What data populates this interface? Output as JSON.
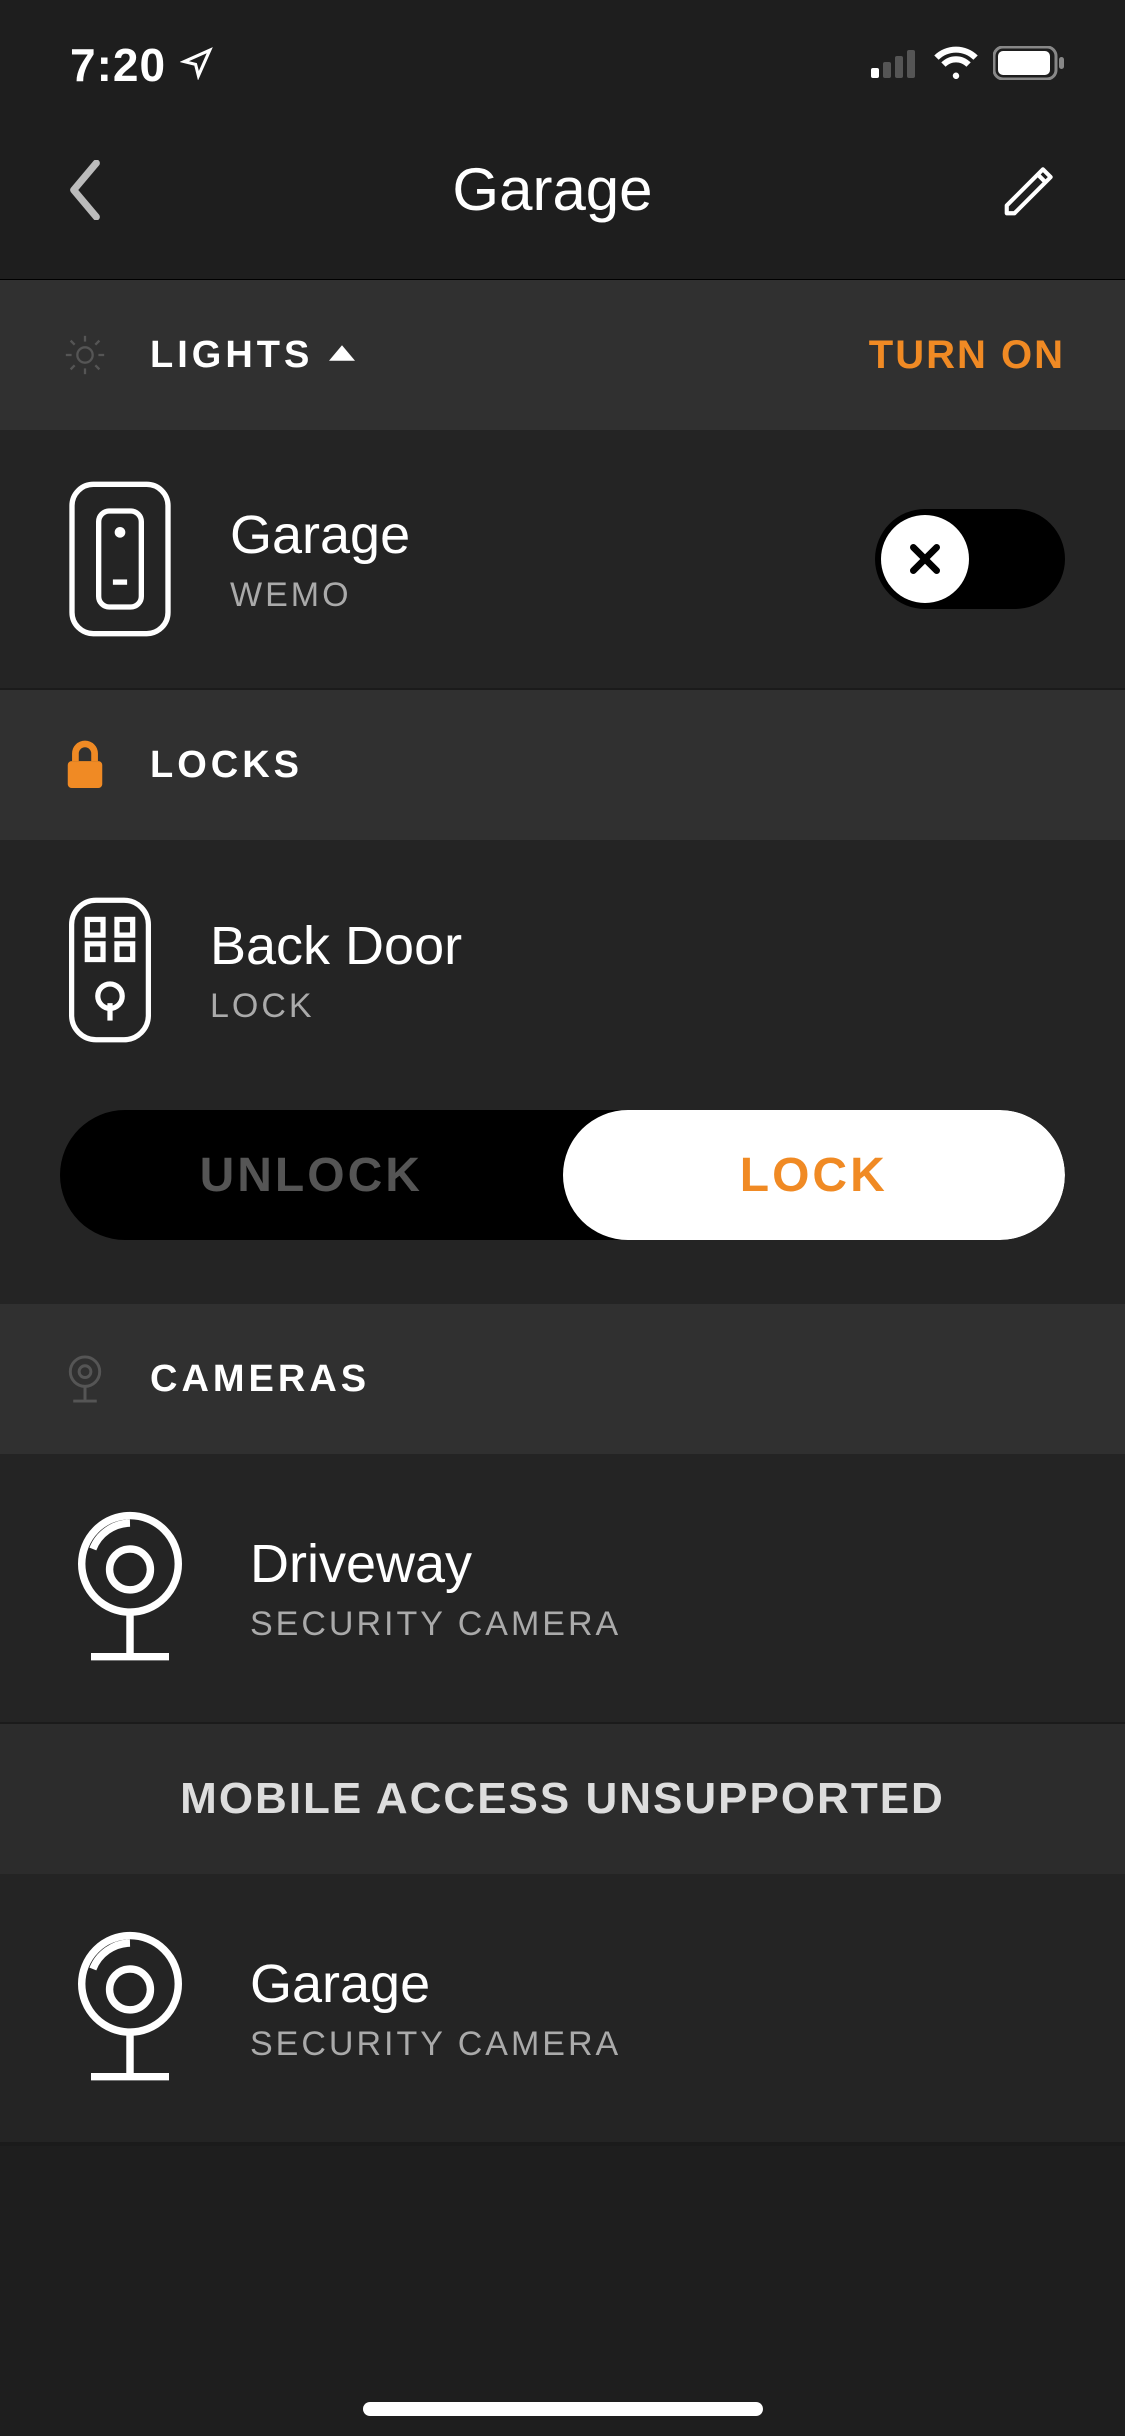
{
  "status": {
    "time": "7:20"
  },
  "nav": {
    "title": "Garage"
  },
  "accent_color": "#f08a24",
  "sections": {
    "lights": {
      "label": "LIGHTS",
      "action": "TURN ON",
      "devices": [
        {
          "name": "Garage",
          "subtype": "WEMO",
          "on": false
        }
      ]
    },
    "locks": {
      "label": "LOCKS",
      "devices": [
        {
          "name": "Back Door",
          "subtype": "LOCK",
          "unlock_label": "UNLOCK",
          "lock_label": "LOCK",
          "state": "locked"
        }
      ]
    },
    "cameras": {
      "label": "CAMERAS",
      "devices": [
        {
          "name": "Driveway",
          "subtype": "SECURITY CAMERA",
          "banner": "MOBILE ACCESS UNSUPPORTED"
        },
        {
          "name": "Garage",
          "subtype": "SECURITY CAMERA"
        }
      ]
    }
  }
}
